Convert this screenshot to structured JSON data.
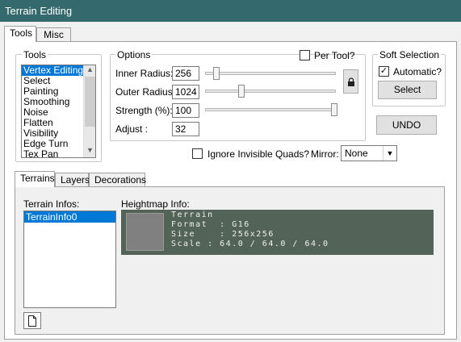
{
  "window": {
    "title": "Terrain Editing"
  },
  "main_tabs": [
    {
      "label": "Tools"
    },
    {
      "label": "Misc"
    }
  ],
  "tools": {
    "group_label": "Tools",
    "items": [
      "Vertex Editing",
      "Select",
      "Painting",
      "Smoothing",
      "Noise",
      "Flatten",
      "Visibility",
      "Edge Turn",
      "Tex Pan"
    ],
    "selected": "Vertex Editing"
  },
  "options": {
    "group_label": "Options",
    "per_tool_label": "Per Tool?",
    "per_tool_checked": false,
    "inner_radius": {
      "label": "Inner Radius:",
      "value": "256",
      "slider": 0.05
    },
    "outer_radius": {
      "label": "Outer Radius:",
      "value": "1024",
      "slider": 0.25
    },
    "strength": {
      "label": "Strength (%):",
      "value": "100",
      "slider": 1.0
    },
    "adjust": {
      "label": "Adjust :",
      "value": "32"
    },
    "lock_icon": "lock-icon"
  },
  "soft_selection": {
    "group_label": "Soft Selection",
    "automatic_label": "Automatic?",
    "automatic_checked": true,
    "select_label": "Select"
  },
  "undo_label": "UNDO",
  "ignore_invisible_label": "Ignore Invisible Quads?",
  "ignore_invisible_checked": false,
  "mirror": {
    "label": "Mirror:",
    "value": "None"
  },
  "sub_tabs": [
    {
      "label": "Terrains"
    },
    {
      "label": "Layers"
    },
    {
      "label": "Decorations"
    }
  ],
  "terrain_infos": {
    "label": "Terrain Infos:",
    "items": [
      "TerrainInfo0"
    ],
    "selected": "TerrainInfo0",
    "new_icon": "new-document-icon"
  },
  "heightmap": {
    "label": "Heightmap Info:",
    "name": "Terrain",
    "format_line": "Format  : G16",
    "size_line": "Size    : 256x256",
    "scale_line": "Scale : 64.0 / 64.0 / 64.0"
  },
  "colors": {
    "titlebar": "#346a6d",
    "selection": "#0078d7",
    "heightmap_bg": "#536357"
  }
}
